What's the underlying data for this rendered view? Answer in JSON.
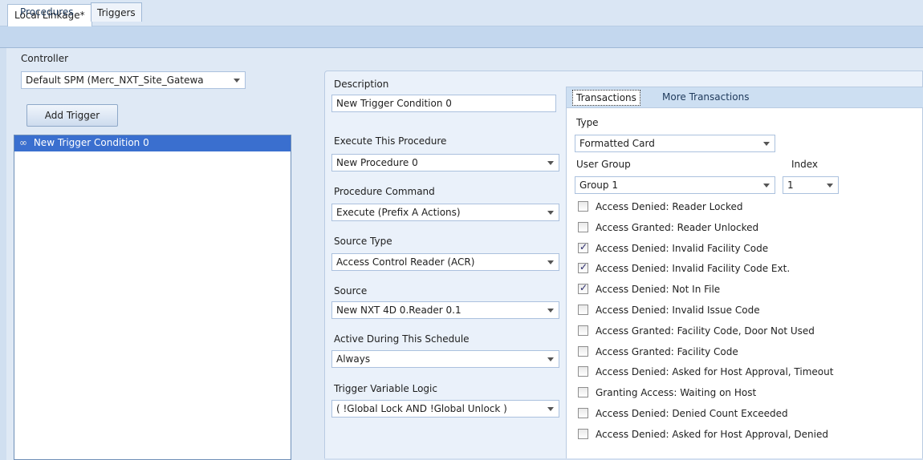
{
  "doc_tab": {
    "label": "Local Linkage*"
  },
  "sub_tabs": [
    {
      "label": "Procedures",
      "active": false
    },
    {
      "label": "Triggers",
      "active": true
    }
  ],
  "left": {
    "controller_label": "Controller",
    "controller_value": "Default SPM (Merc_NXT_Site_Gatewa",
    "add_trigger_label": "Add Trigger",
    "triggers": [
      {
        "label": "New Trigger Condition 0",
        "selected": true
      }
    ]
  },
  "form": {
    "description_label": "Description",
    "description_value": "New Trigger Condition 0",
    "execute_label": "Execute This Procedure",
    "execute_value": "New Procedure 0",
    "command_label": "Procedure Command",
    "command_value": "Execute (Prefix A Actions)",
    "source_type_label": "Source Type",
    "source_type_value": "Access Control Reader (ACR)",
    "source_label": "Source",
    "source_value": "New NXT 4D 0.Reader 0.1",
    "schedule_label": "Active During This Schedule",
    "schedule_value": "Always",
    "logic_label": "Trigger Variable Logic",
    "logic_value": "( !Global Lock AND !Global Unlock )"
  },
  "transactions": {
    "tabs": [
      {
        "label": "Transactions",
        "active": true
      },
      {
        "label": "More Transactions",
        "active": false
      }
    ],
    "type_label": "Type",
    "type_value": "Formatted Card",
    "user_group_label": "User Group",
    "user_group_value": "Group 1",
    "index_label": "Index",
    "index_value": "1",
    "checkboxes": [
      {
        "label": "Access Denied: Reader Locked",
        "checked": false
      },
      {
        "label": "Access Granted: Reader Unlocked",
        "checked": false
      },
      {
        "label": "Access Denied: Invalid Facility Code",
        "checked": true
      },
      {
        "label": "Access Denied: Invalid Facility Code Ext.",
        "checked": true
      },
      {
        "label": "Access Denied: Not In File",
        "checked": true
      },
      {
        "label": "Access Denied: Invalid Issue Code",
        "checked": false
      },
      {
        "label": "Access Granted: Facility Code, Door Not Used",
        "checked": false
      },
      {
        "label": "Access Granted: Facility Code",
        "checked": false
      },
      {
        "label": "Access Denied: Asked for Host Approval, Timeout",
        "checked": false
      },
      {
        "label": "Granting Access: Waiting on Host",
        "checked": false
      },
      {
        "label": "Access Denied: Denied Count Exceeded",
        "checked": false
      },
      {
        "label": "Access Denied: Asked for Host Approval, Denied",
        "checked": false
      }
    ]
  },
  "icons": {
    "trigger_item": "link-icon",
    "combo_arrow": "chevron-down-icon"
  },
  "colors": {
    "selection": "#3a6fcf",
    "pane_bg": "#dfe9f5",
    "tab_strip": "#c3d7ee"
  }
}
